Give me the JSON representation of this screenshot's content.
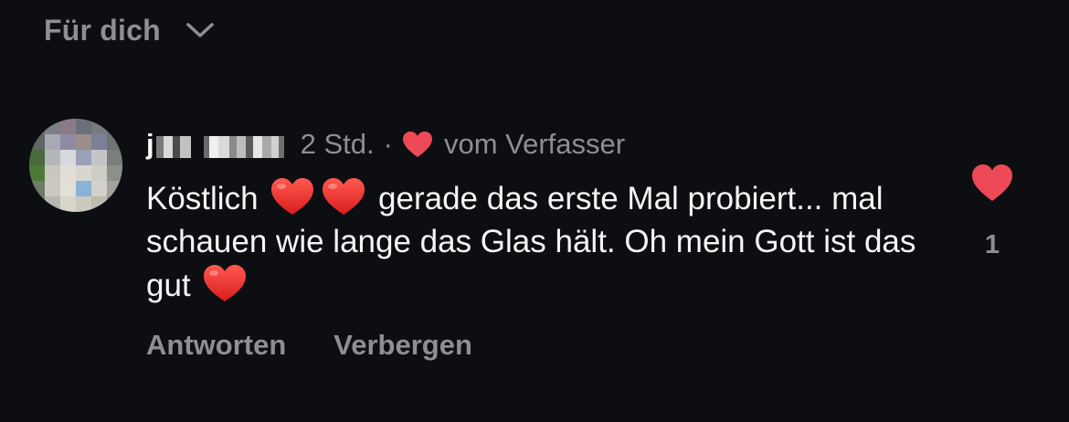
{
  "filter": {
    "label": "Für dich",
    "icon": "chevron-down-icon"
  },
  "comment": {
    "avatar_icon": "avatar",
    "username_visible_char": "j",
    "username_note": "pixelated",
    "time": "2 Std.",
    "separator": "·",
    "liked_by_author_icon": "heart-icon",
    "liked_by_author_label": "vom Verfasser",
    "text_parts": {
      "part1": "Köstlich",
      "part2": "gerade das erste Mal probiert... mal schauen wie lange das Glas hält. Oh mein Gott ist das gut"
    },
    "like_count": "1",
    "actions": {
      "reply": "Antworten",
      "hide": "Verbergen"
    }
  },
  "colors": {
    "background": "#0d0e12",
    "secondary_text": "#8e8e93",
    "primary_text": "#f5f5f5",
    "heart_red": "#ed4956"
  }
}
